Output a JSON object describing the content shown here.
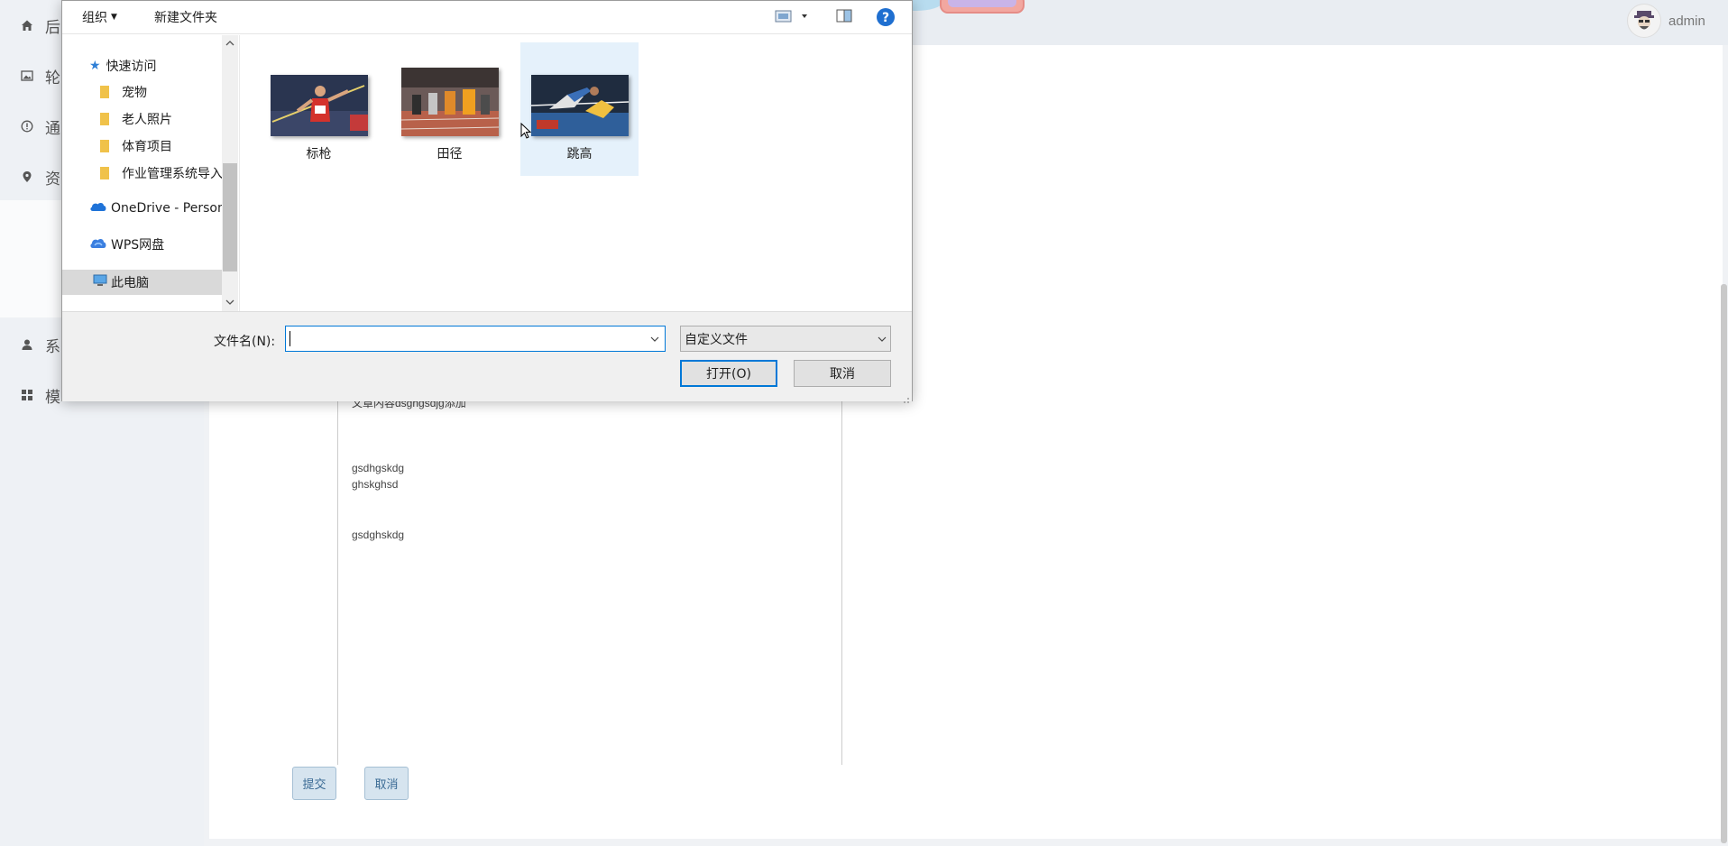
{
  "app": {
    "user_name": "admin",
    "sidebar_items": [
      {
        "label": "后",
        "icon": "home-icon"
      },
      {
        "label": "轮",
        "icon": "image-icon"
      },
      {
        "label": "通",
        "icon": "info-circle-icon"
      },
      {
        "label": "资",
        "icon": "location-pin-icon"
      },
      {
        "label": "系",
        "icon": "user-icon"
      },
      {
        "label": "模",
        "icon": "grid-icon"
      }
    ],
    "editor_lines": [
      "文章内容dsghgsdjg添加",
      "gsdhgskdg",
      "ghskghsd",
      "gsdghskdg"
    ],
    "submit_label": "提交",
    "cancel_label": "取消"
  },
  "dialog": {
    "toolbar": {
      "organize_label": "组织",
      "new_folder_label": "新建文件夹"
    },
    "nav": {
      "quick_access_label": "快速访问",
      "folders": [
        "宠物",
        "老人照片",
        "体育项目",
        "作业管理系统导入"
      ],
      "onedrive_label": "OneDrive - Personal",
      "wps_label": "WPS网盘",
      "this_pc_label": "此电脑"
    },
    "files": [
      {
        "name": "标枪",
        "selected": false
      },
      {
        "name": "田径",
        "selected": false
      },
      {
        "name": "跳高",
        "selected": true
      }
    ],
    "filename_label": "文件名(N):",
    "filename_value": "",
    "filetype_selected": "自定义文件",
    "open_label": "打开(O)",
    "cancel_label": "取消"
  },
  "colors": {
    "accent": "#0078d7",
    "selection": "#e5f1fb",
    "nav_selected": "#d9d9d9",
    "web_button": "#d6e4ef"
  }
}
